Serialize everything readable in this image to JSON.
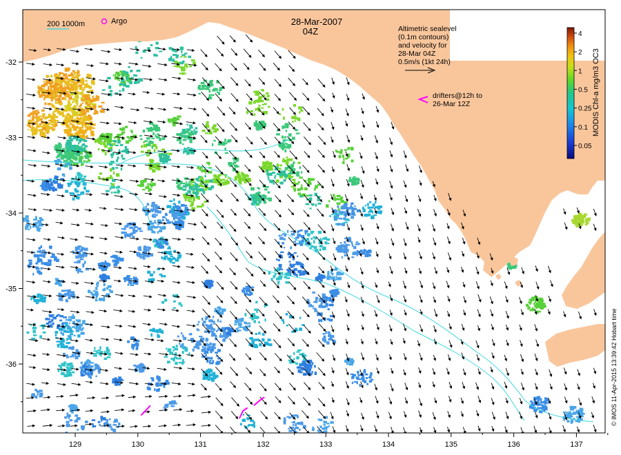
{
  "header": {
    "date": "28-Mar-2007",
    "time": "04Z"
  },
  "scale_label": "200  1000m",
  "argo_label": "Argo",
  "legend": {
    "line1": "Altimetric sealevel",
    "line2": "(0.1m contours)",
    "line3": "and velocity for",
    "line4": "28-Mar 04Z",
    "line5": "0.5m/s (1kt 24h)"
  },
  "drifters": {
    "line1": "drifters@12h to",
    "line2": "26-Mar 12Z"
  },
  "colorbar": {
    "title": "MODIS Chl-a mg/m3 OC3",
    "ticks": [
      "4",
      "2",
      "1",
      "0.5",
      "0.25",
      "0.1",
      "0.05"
    ]
  },
  "credit": "© IMOS 11-Apr-2015 13:39:42 Hobart time",
  "axes": {
    "lon_ticks": [
      "129",
      "130",
      "131",
      "132",
      "133",
      "134",
      "135",
      "136",
      "137"
    ],
    "lat_ticks": [
      "-32",
      "-33",
      "-34",
      "-35",
      "-36"
    ]
  },
  "colors": {
    "land": "#f9c69c",
    "current_contour": "#40d8e0",
    "drifter": "#ff00ff",
    "argo": "#ff00ff"
  },
  "map_data": {
    "lon_range": [
      128.2,
      137.5
    ],
    "lat_range": [
      -36.9,
      -31.4
    ],
    "drifter_tracks": [
      [
        [
          130.05,
          -36.68
        ],
        [
          130.12,
          -36.62
        ],
        [
          130.2,
          -36.55
        ]
      ],
      [
        [
          131.62,
          -36.72
        ],
        [
          131.68,
          -36.62
        ],
        [
          131.75,
          -36.58
        ]
      ],
      [
        [
          131.85,
          -36.55
        ],
        [
          131.95,
          -36.48
        ],
        [
          132.02,
          -36.44
        ]
      ]
    ]
  }
}
